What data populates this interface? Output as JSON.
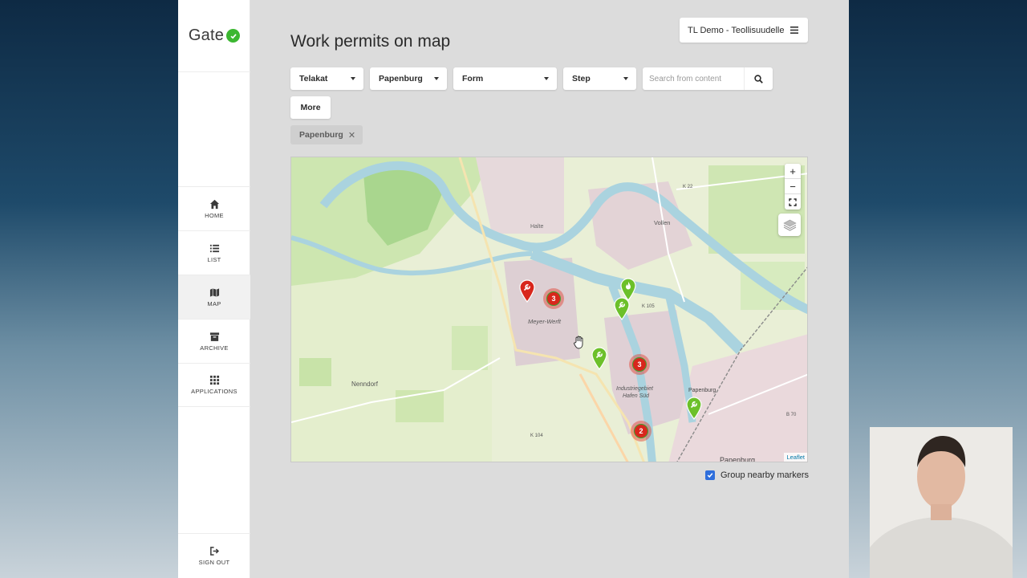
{
  "app": {
    "logo_text": "Gate",
    "page_title": "Work permits on map",
    "org_selector": "TL Demo - Teollisuudelle"
  },
  "sidebar": {
    "items": [
      {
        "label": "HOME",
        "icon": "home-icon"
      },
      {
        "label": "LIST",
        "icon": "list-icon"
      },
      {
        "label": "MAP",
        "icon": "map-icon",
        "active": true
      },
      {
        "label": "ARCHIVE",
        "icon": "archive-icon"
      },
      {
        "label": "APPLICATIONS",
        "icon": "grid-icon"
      }
    ],
    "signout": "SIGN OUT"
  },
  "filters": {
    "telakat": "Telakat",
    "location": "Papenburg",
    "form": "Form",
    "step": "Step",
    "search_placeholder": "Search from content",
    "more": "More",
    "active_chip": "Papenburg"
  },
  "map": {
    "zoom_in": "+",
    "zoom_out": "−",
    "attribution": "Leaflet",
    "labels": {
      "halte": "Halte",
      "meyer_werft": "Meyer-Werft",
      "nenndorf": "Nenndorf",
      "industriegebiet": "Industriegebiet",
      "hafen_sud": "Hafen Süd",
      "papenburg_top": "Papenburg",
      "papenburg_bottom": "Papenburg",
      "vollen": "Vollen",
      "k22": "K 22",
      "k105": "K 105",
      "k104": "K 104",
      "b70": "B 70"
    },
    "clusters": [
      "3",
      "3",
      "2"
    ],
    "group_nearby": "Group nearby markers",
    "group_nearby_checked": true
  },
  "colors": {
    "brand_green": "#3cb731",
    "marker_red": "#d8261c",
    "marker_green": "#6cc02a",
    "checkbox_blue": "#2f6fdc"
  }
}
